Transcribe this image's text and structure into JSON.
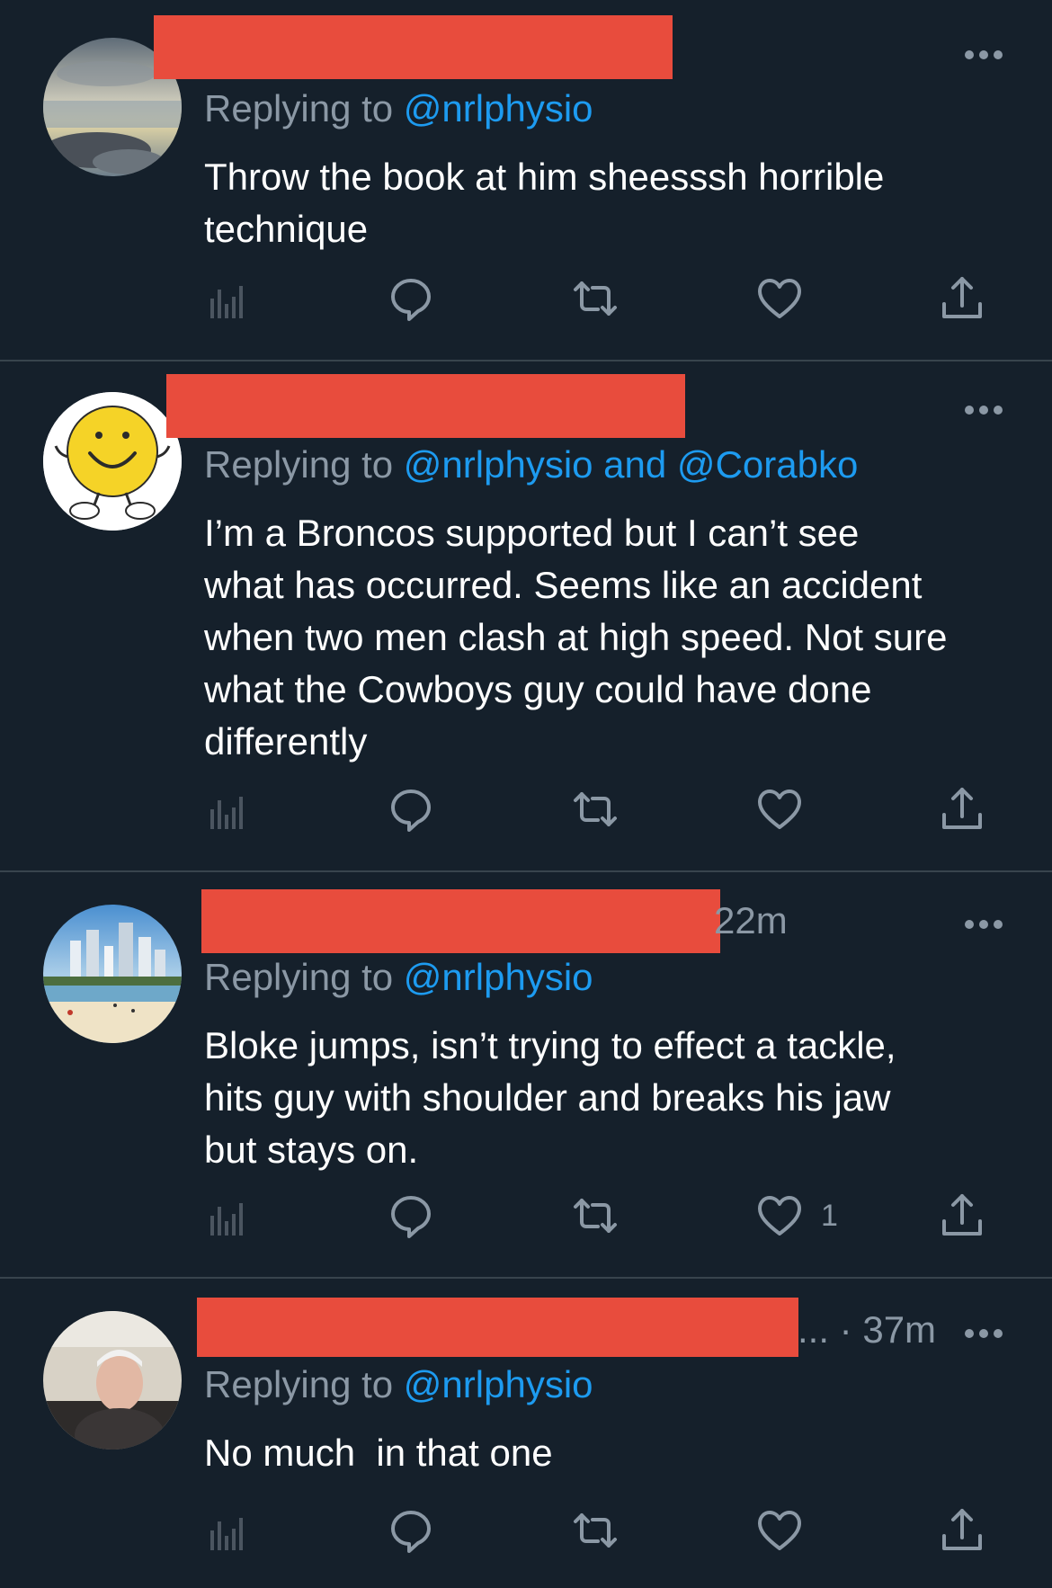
{
  "colors": {
    "background": "#15202b",
    "text": "#ffffff",
    "secondary": "#8b98a5",
    "link": "#1d9bf0",
    "redaction": "#e84c3d",
    "divider": "#38444d"
  },
  "tweets": [
    {
      "replying_prefix": "Replying to ",
      "replying_mentions": "@nrlphysio",
      "meta": "",
      "text": "Throw the book at him sheesssh horrible\ntechnique",
      "like_count": "",
      "avatar_icon": "landscape-avatar"
    },
    {
      "replying_prefix": "Replying to ",
      "replying_mentions": "@nrlphysio and @Corabko",
      "meta": "",
      "text": "I’m a Broncos supported but I can’t see\nwhat has occurred. Seems like an accident\nwhen two men clash at high speed. Not sure\nwhat the Cowboys guy could have done\ndifferently",
      "like_count": "",
      "avatar_icon": "smiley-avatar"
    },
    {
      "replying_prefix": "Replying to ",
      "replying_mentions": "@nrlphysio",
      "meta": "22m",
      "text": "Bloke jumps, isn’t trying to effect a tackle,\nhits guy with shoulder and breaks his jaw\nbut stays on.",
      "like_count": "1",
      "avatar_icon": "beach-city-avatar"
    },
    {
      "replying_prefix": "Replying to ",
      "replying_mentions": "@nrlphysio",
      "meta": "... · 37m",
      "text": "No much  in that one",
      "like_count": "",
      "avatar_icon": "person-avatar"
    }
  ]
}
